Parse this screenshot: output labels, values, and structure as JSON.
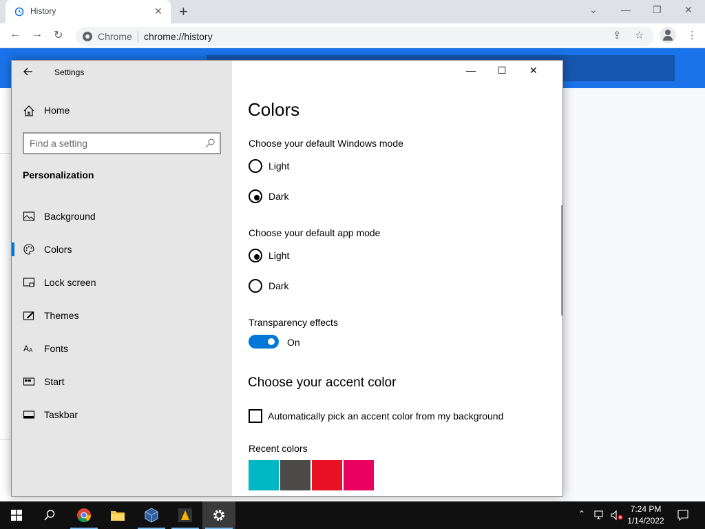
{
  "browser": {
    "tab_title": "History",
    "omnibox_chip": "Chrome",
    "url": "chrome://history"
  },
  "settings": {
    "window_title": "Settings",
    "nav": {
      "home_label": "Home",
      "search_placeholder": "Find a setting",
      "section_title": "Personalization",
      "items": [
        {
          "label": "Background",
          "icon": "image-icon"
        },
        {
          "label": "Colors",
          "icon": "palette-icon",
          "selected": true
        },
        {
          "label": "Lock screen",
          "icon": "lock-screen-icon"
        },
        {
          "label": "Themes",
          "icon": "themes-icon"
        },
        {
          "label": "Fonts",
          "icon": "fonts-icon"
        },
        {
          "label": "Start",
          "icon": "start-icon"
        },
        {
          "label": "Taskbar",
          "icon": "taskbar-icon"
        }
      ]
    },
    "main": {
      "title": "Colors",
      "windows_mode_label": "Choose your default Windows mode",
      "windows_mode_options": [
        "Light",
        "Dark"
      ],
      "windows_mode_selected": "Dark",
      "app_mode_label": "Choose your default app mode",
      "app_mode_options": [
        "Light",
        "Dark"
      ],
      "app_mode_selected": "Light",
      "transparency_label": "Transparency effects",
      "transparency_state": "On",
      "accent_heading": "Choose your accent color",
      "auto_accent_label": "Automatically pick an accent color from my background",
      "recent_colors_label": "Recent colors",
      "recent_colors": [
        "#00b7c3",
        "#4c4a48",
        "#e81123",
        "#ea005e"
      ]
    }
  },
  "taskbar": {
    "time": "7:24 PM",
    "date": "1/14/2022"
  },
  "colors": {
    "accent": "#0078d7",
    "chrome_blue": "#1a73e8"
  }
}
